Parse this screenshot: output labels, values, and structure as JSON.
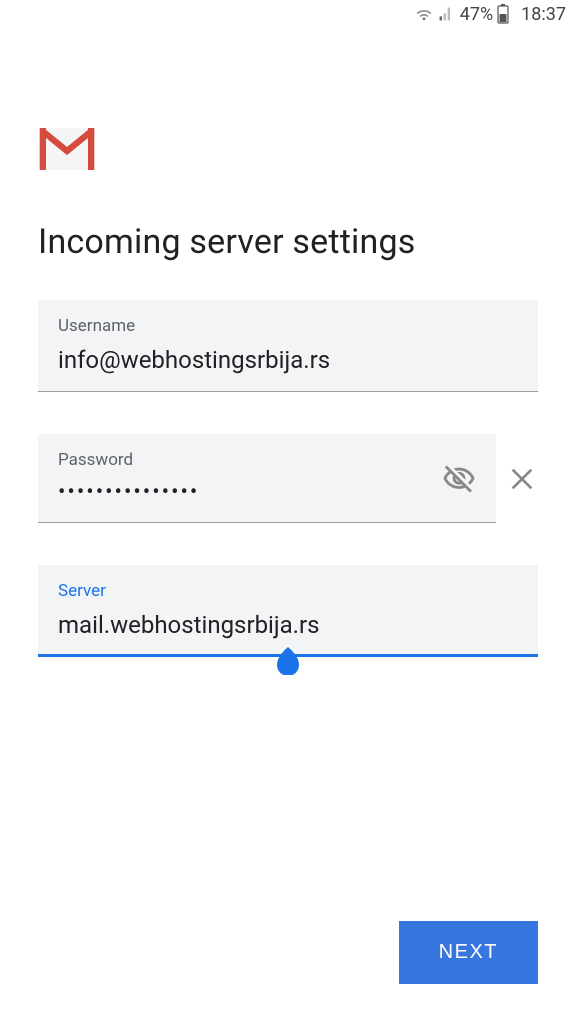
{
  "status_bar": {
    "battery_pct": "47%",
    "time": "18:37"
  },
  "title": "Incoming server settings",
  "fields": {
    "username": {
      "label": "Username",
      "value": "info@webhostingsrbija.rs"
    },
    "password": {
      "label": "Password",
      "value": "•••••••••••••••"
    },
    "server": {
      "label": "Server",
      "value": "mail.webhostingsrbija.rs"
    }
  },
  "buttons": {
    "next": "NEXT"
  }
}
